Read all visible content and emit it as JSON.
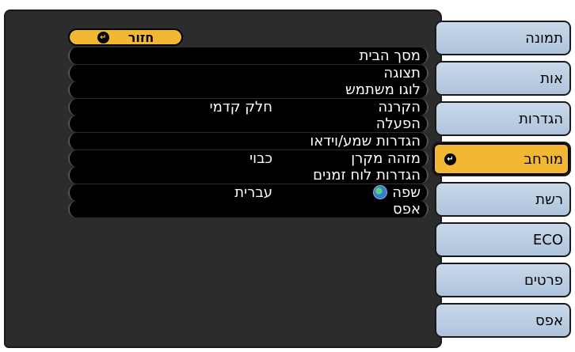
{
  "back": {
    "label": "חזור",
    "icon": "enter-icon"
  },
  "menu": [
    {
      "label": "מסך הבית",
      "value": ""
    },
    {
      "label": "תצוגה",
      "value": ""
    },
    {
      "label": "לוגו משתמש",
      "value": ""
    },
    {
      "label": "הקרנה",
      "value": "חלק קדמי"
    },
    {
      "label": "הפעלה",
      "value": ""
    },
    {
      "label": "הגדרות שמע/וידאו",
      "value": ""
    },
    {
      "label": "מזהה מקרן",
      "value": "כבוי"
    },
    {
      "label": "הגדרות לוח זמנים",
      "value": ""
    },
    {
      "label": "שפה",
      "value": "עברית",
      "icon": "globe-icon"
    },
    {
      "label": "אפס",
      "value": ""
    }
  ],
  "tabs": [
    {
      "label": "תמונה",
      "active": false
    },
    {
      "label": "אות",
      "active": false
    },
    {
      "label": "הגדרות",
      "active": false
    },
    {
      "label": "מורחב",
      "active": true
    },
    {
      "label": "רשת",
      "active": false
    },
    {
      "label": "ECO",
      "active": false
    },
    {
      "label": "פרטים",
      "active": false
    },
    {
      "label": "אפס",
      "active": false
    }
  ],
  "colors": {
    "accent": "#f2b833",
    "panel": "#2c2c2c",
    "tab": "#bcd0e6",
    "row": "#000000"
  }
}
